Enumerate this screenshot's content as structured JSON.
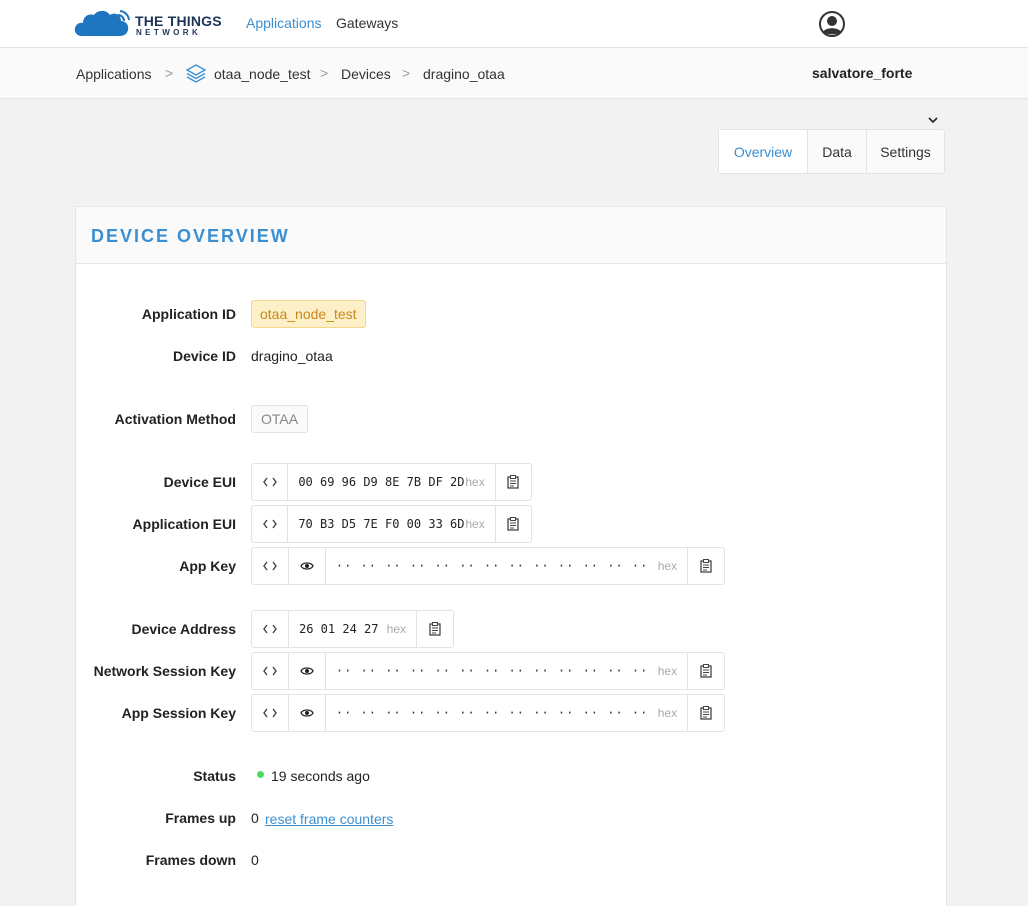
{
  "brand": {
    "line1": "THE THINGS",
    "line2": "NETWORK"
  },
  "nav": {
    "applications": "Applications",
    "gateways": "Gateways"
  },
  "breadcrumb": {
    "applications": "Applications",
    "app": "otaa_node_test",
    "devices": "Devices",
    "device": "dragino_otaa",
    "separator": ">"
  },
  "user": {
    "name": "salvatore_forte"
  },
  "tabs": {
    "overview": "Overview",
    "data": "Data",
    "settings": "Settings"
  },
  "panel": {
    "title": "DEVICE OVERVIEW"
  },
  "device": {
    "application_id_label": "Application ID",
    "application_id": "otaa_node_test",
    "device_id_label": "Device ID",
    "device_id": "dragino_otaa",
    "activation_method_label": "Activation Method",
    "activation_method": "OTAA",
    "device_eui_label": "Device EUI",
    "device_eui": "00 69 96 D9 8E 7B DF 2D",
    "application_eui_label": "Application EUI",
    "application_eui": "70 B3 D5 7E F0 00 33 6D",
    "app_key_label": "App Key",
    "app_key_masked": "·· ·· ·· ·· ·· ·· ·· ·· ·· ·· ·· ·· ·· ·· ·· ··",
    "device_address_label": "Device Address",
    "device_address": "26 01 24 27",
    "nwk_skey_label": "Network Session Key",
    "nwk_skey_masked": "·· ·· ·· ·· ·· ·· ·· ·· ·· ·· ·· ·· ·· ·· ·· ··",
    "app_skey_label": "App Session Key",
    "app_skey_masked": "·· ·· ·· ·· ·· ·· ·· ·· ·· ·· ·· ·· ·· ·· ·· ··",
    "hex": "hex",
    "status_label": "Status",
    "status": "19 seconds ago",
    "frames_up_label": "Frames up",
    "frames_up": "0",
    "reset_link": "reset frame counters",
    "frames_down_label": "Frames down",
    "frames_down": "0"
  },
  "colors": {
    "accent": "#3b8fd1",
    "status_ok": "#4cd964",
    "tag_bg": "#fdefc8",
    "tag_text": "#c8891c"
  },
  "icons": [
    "cloud-logo-icon",
    "user-avatar-icon",
    "layers-app-icon",
    "chevron-down-icon",
    "code-toggle-icon",
    "eye-icon",
    "clipboard-icon"
  ]
}
